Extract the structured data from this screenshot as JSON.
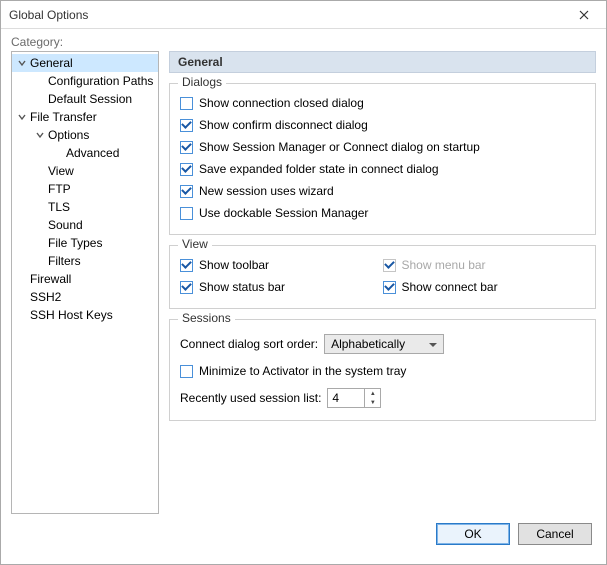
{
  "window": {
    "title": "Global Options",
    "category_label": "Category:"
  },
  "tree": {
    "items": [
      {
        "label": "General",
        "depth": 0,
        "expanded": true,
        "selected": true
      },
      {
        "label": "Configuration Paths",
        "depth": 1
      },
      {
        "label": "Default Session",
        "depth": 1
      },
      {
        "label": "File Transfer",
        "depth": 0,
        "expanded": true
      },
      {
        "label": "Options",
        "depth": 1,
        "expanded": true
      },
      {
        "label": "Advanced",
        "depth": 2
      },
      {
        "label": "View",
        "depth": 1
      },
      {
        "label": "FTP",
        "depth": 1
      },
      {
        "label": "TLS",
        "depth": 1
      },
      {
        "label": "Sound",
        "depth": 1
      },
      {
        "label": "File Types",
        "depth": 1
      },
      {
        "label": "Filters",
        "depth": 1
      },
      {
        "label": "Firewall",
        "depth": 0
      },
      {
        "label": "SSH2",
        "depth": 0
      },
      {
        "label": "SSH Host Keys",
        "depth": 0
      }
    ]
  },
  "panel": {
    "heading": "General",
    "groups": {
      "dialogs": {
        "title": "Dialogs",
        "items": [
          {
            "label": "Show connection closed dialog",
            "checked": false
          },
          {
            "label": "Show confirm disconnect dialog",
            "checked": true
          },
          {
            "label": "Show Session Manager or Connect dialog on startup",
            "checked": true
          },
          {
            "label": "Save expanded folder state in connect dialog",
            "checked": true
          },
          {
            "label": "New session uses wizard",
            "checked": true
          },
          {
            "label": "Use dockable Session Manager",
            "checked": false
          }
        ]
      },
      "view": {
        "title": "View",
        "items": [
          {
            "label": "Show toolbar",
            "checked": true
          },
          {
            "label": "Show menu bar",
            "checked": true,
            "disabled": true
          },
          {
            "label": "Show status bar",
            "checked": true
          },
          {
            "label": "Show connect bar",
            "checked": true
          }
        ]
      },
      "sessions": {
        "title": "Sessions",
        "sort_label": "Connect dialog sort order:",
        "sort_value": "Alphabetically",
        "minimize": {
          "label": "Minimize to Activator in the system tray",
          "checked": false
        },
        "recent_label": "Recently used session list:",
        "recent_value": "4"
      }
    }
  },
  "footer": {
    "ok": "OK",
    "cancel": "Cancel"
  }
}
